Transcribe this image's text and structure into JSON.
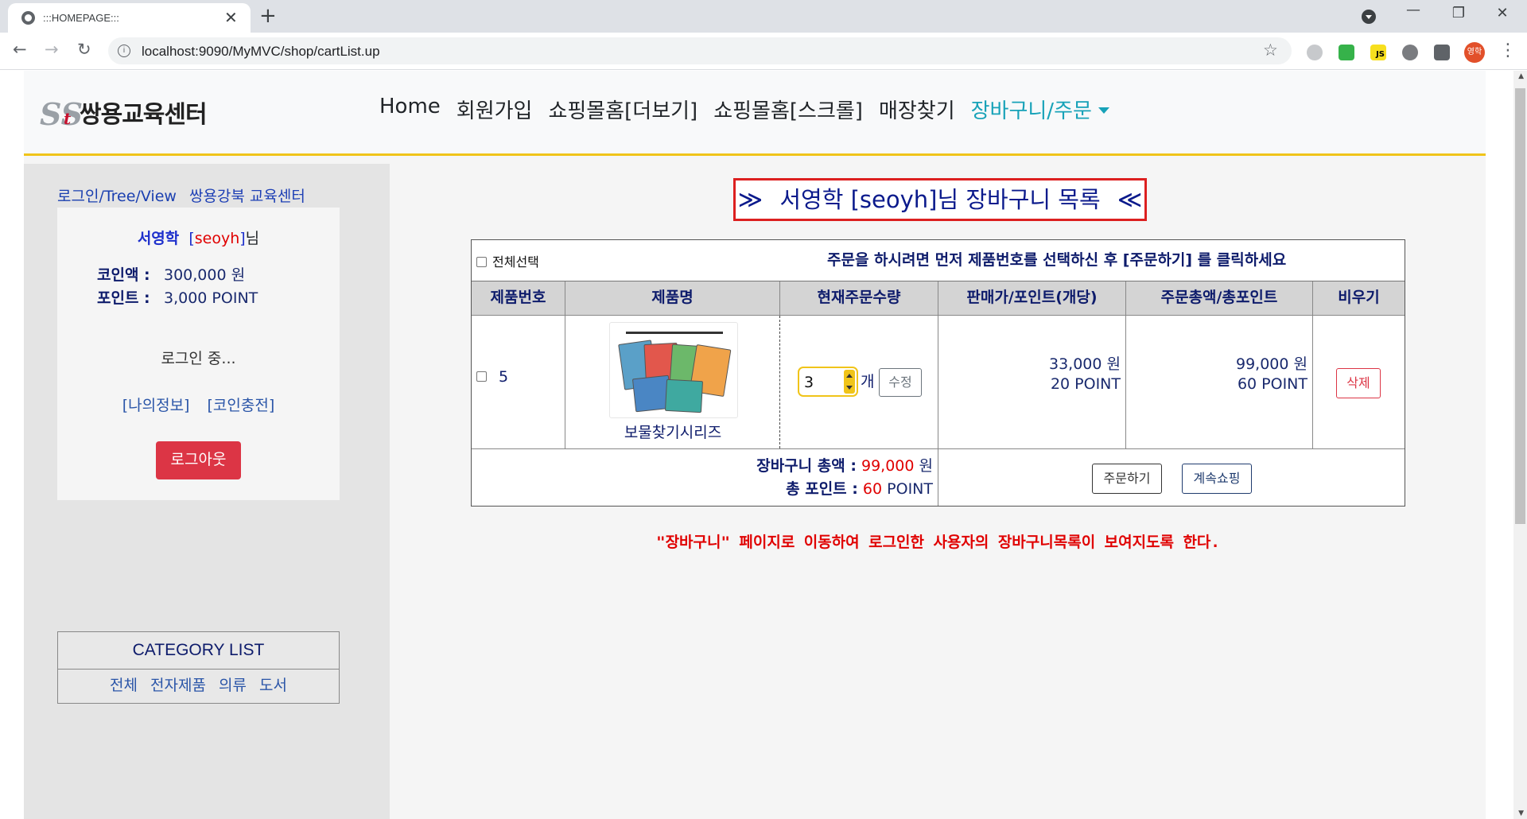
{
  "browser": {
    "tab_title": ":::HOMEPAGE:::",
    "url": "localhost:9090/MyMVC/shop/cartList.up",
    "profile_initials": "영학",
    "js_ext_label": "JS"
  },
  "site": {
    "logo_mark": "SS",
    "logo_mark_t": "t",
    "logo_text": "쌍용교육센터",
    "accent_color": "#17a2b8",
    "header_border_color": "#f0c419",
    "nav": [
      {
        "label": "Home"
      },
      {
        "label": "회원가입"
      },
      {
        "label": "쇼핑몰홈[더보기]"
      },
      {
        "label": "쇼핑몰홈[스크롤]"
      },
      {
        "label": "매장찾기"
      },
      {
        "label": "장바구니/주문",
        "active": true
      }
    ]
  },
  "sidebar": {
    "tree_link": "로그인/Tree/View",
    "center_link": "쌍용강북 교육센터",
    "user": {
      "name": "서영학",
      "id_open": "[",
      "id": "seoyh",
      "id_close": "]",
      "suffix": "님",
      "coin_label": "코인액 :",
      "coin_value": "300,000 원",
      "point_label": "포인트 :",
      "point_value": "3,000 POINT",
      "status": "로그인 중...",
      "link_myinfo": "[나의정보]",
      "link_coin": "[코인충전]",
      "logout_label": "로그아웃"
    },
    "category": {
      "title": "CATEGORY LIST",
      "items": [
        "전체",
        "전자제품",
        "의류",
        "도서"
      ]
    }
  },
  "cart": {
    "title": "서영학 [seoyh]님 장바구니 목록",
    "chev_left": "≫",
    "chev_right": "≪",
    "select_all_label": "전체선택",
    "instruction": "주문을 하시려면 먼저 제품번호를 선택하신 후 [주문하기] 를 클릭하세요",
    "headers": [
      "제품번호",
      "제품명",
      "현재주문수량",
      "판매가/포인트(개당)",
      "주문총액/총포인트",
      "비우기"
    ],
    "rows": [
      {
        "product_no": "5",
        "product_name": "보물찾기시리즈",
        "quantity": "3",
        "unit": "개",
        "edit_label": "수정",
        "unit_price": "33,000 원",
        "unit_point": "20 POINT",
        "total_price": "99,000 원",
        "total_point": "60 POINT",
        "delete_label": "삭제"
      }
    ],
    "summary": {
      "total_label": "장바구니 총액 :",
      "total_value": "99,000",
      "total_unit": "원",
      "point_label": "총 포인트 :",
      "point_value": "60",
      "point_unit": "POINT"
    },
    "order_button": "주문하기",
    "continue_button": "계속쇼핑",
    "note": "\"장바구니\" 페이지로 이동하여 로그인한 사용자의 장바구니목록이 보여지도록 한다."
  }
}
